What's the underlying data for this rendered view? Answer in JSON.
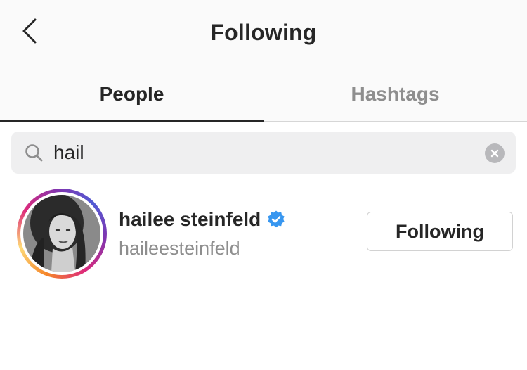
{
  "header": {
    "title": "Following",
    "back_icon": "chevron-left-icon"
  },
  "tabs": [
    {
      "label": "People",
      "active": true
    },
    {
      "label": "Hashtags",
      "active": false
    }
  ],
  "search": {
    "value": "hail",
    "search_icon": "search-icon",
    "clear_icon": "clear-icon"
  },
  "results": [
    {
      "name": "hailee steinfeld",
      "verified": true,
      "handle": "haileesteinfeld",
      "button_label": "Following"
    }
  ],
  "colors": {
    "verified_badge": "#3897f0",
    "active_tab": "#262626",
    "inactive_tab": "#8e8e8e",
    "secondary_text": "#8e8e8e"
  }
}
